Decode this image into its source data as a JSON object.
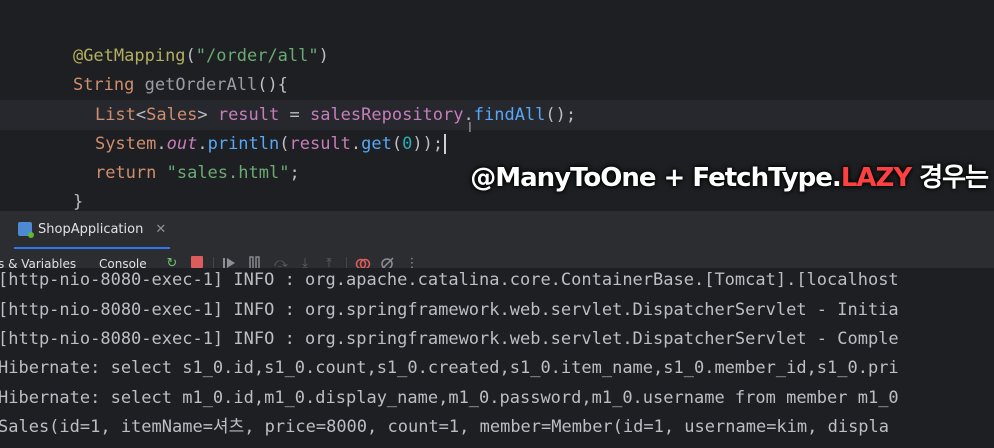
{
  "editor": {
    "line1": {
      "annotation": "@GetMapping",
      "open": "(",
      "path": "\"/order/all\"",
      "close": ")"
    },
    "line2": {
      "type": "String ",
      "method": "getOrderAll",
      "rest": "(){"
    },
    "line3": {
      "type1": "List",
      "lt": "<",
      "type2": "Sales",
      "gt": ">",
      "var": " result",
      "eq": " = ",
      "repo": "salesRepository",
      "dot": ".",
      "meth": "findAll",
      "rest": "();"
    },
    "line4": {
      "cls": "System",
      "dot1": ".",
      "field": "out",
      "dot2": ".",
      "meth1": "println",
      "p1": "(",
      "var": "result",
      "dot3": ".",
      "meth2": "get",
      "p2": "(",
      "num": "0",
      "rest": "));"
    },
    "line5": {
      "kw": "return ",
      "str": "\"sales.html\"",
      "rest": ";"
    },
    "line6": {
      "brace": "}"
    }
  },
  "overlay": {
    "part1": "@ManyToOne + FetchType.",
    "lazy": "LAZY",
    "part2": " 경우는"
  },
  "run_window": {
    "tab_label": "ShopApplication",
    "close_glyph": "✕",
    "toolbar": {
      "left_label": "s & Variables",
      "console_label": "Console"
    }
  },
  "console": {
    "lines": [
      "[http-nio-8080-exec-1] INFO : org.apache.catalina.core.ContainerBase.[Tomcat].[localhost",
      "[http-nio-8080-exec-1] INFO : org.springframework.web.servlet.DispatcherServlet - Initia",
      "[http-nio-8080-exec-1] INFO : org.springframework.web.servlet.DispatcherServlet - Comple",
      "Hibernate: select s1_0.id,s1_0.count,s1_0.created,s1_0.item_name,s1_0.member_id,s1_0.pri",
      "Hibernate: select m1_0.id,m1_0.display_name,m1_0.password,m1_0.username from member m1_0",
      "Sales(id=1, itemName=셔츠, price=8000, count=1, member=Member(id=1, username=kim, displa"
    ]
  }
}
